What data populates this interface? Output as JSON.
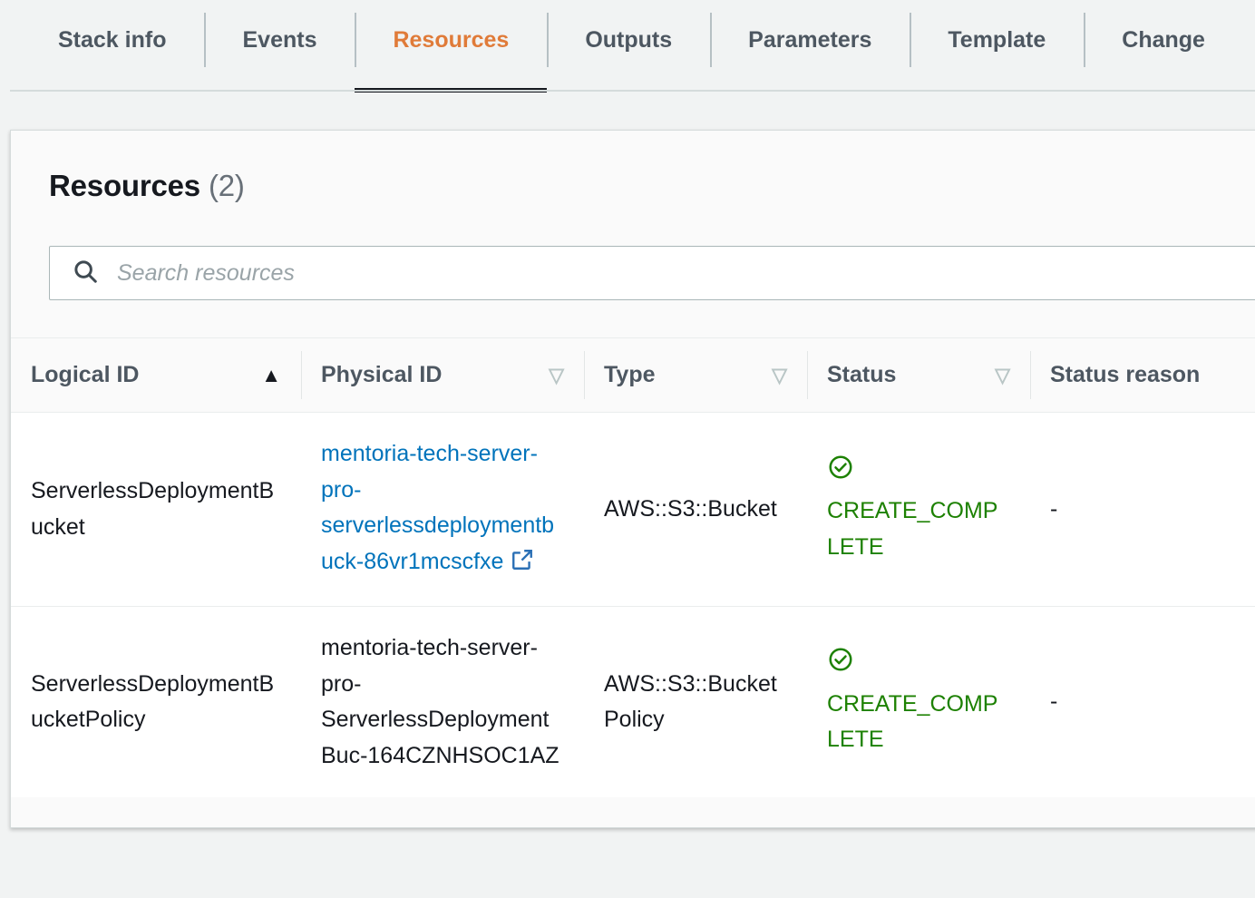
{
  "tabs": [
    {
      "label": "Stack info",
      "active": false
    },
    {
      "label": "Events",
      "active": false
    },
    {
      "label": "Resources",
      "active": true
    },
    {
      "label": "Outputs",
      "active": false
    },
    {
      "label": "Parameters",
      "active": false
    },
    {
      "label": "Template",
      "active": false
    },
    {
      "label": "Change",
      "active": false
    }
  ],
  "panel": {
    "title": "Resources",
    "count": "(2)"
  },
  "search": {
    "placeholder": "Search resources",
    "value": "",
    "icon": "search-icon"
  },
  "table": {
    "columns": [
      {
        "label": "Logical ID",
        "sort": "ascending",
        "sort_glyph": "▲"
      },
      {
        "label": "Physical ID",
        "sort": "none",
        "sort_glyph": "▽"
      },
      {
        "label": "Type",
        "sort": "none",
        "sort_glyph": "▽"
      },
      {
        "label": "Status",
        "sort": "none",
        "sort_glyph": "▽"
      },
      {
        "label": "Status reason",
        "sort": "",
        "sort_glyph": ""
      }
    ],
    "rows": [
      {
        "logical_id": "ServerlessDeploymentBucket",
        "physical_id": "mentoria-tech-server-pro-serverlessdeploymentbuck-86vr1mcscfxe",
        "physical_id_is_link": true,
        "physical_id_icon": "external-link-icon",
        "type": "AWS::S3::Bucket",
        "status": "CREATE_COMPLETE",
        "status_icon": "check-circle-icon",
        "status_reason": "-"
      },
      {
        "logical_id": "ServerlessDeploymentBucketPolicy",
        "physical_id": "mentoria-tech-server-pro-ServerlessDeploymentBuc-164CZNHSOC1AZ",
        "physical_id_is_link": false,
        "physical_id_icon": "",
        "type": "AWS::S3::BucketPolicy",
        "status": "CREATE_COMPLETE",
        "status_icon": "check-circle-icon",
        "status_reason": "-"
      }
    ]
  },
  "colors": {
    "active_tab": "#e07b39",
    "link": "#0073bb",
    "status_success": "#1d8102",
    "page_bg": "#f1f3f3",
    "text": "#16191f"
  }
}
